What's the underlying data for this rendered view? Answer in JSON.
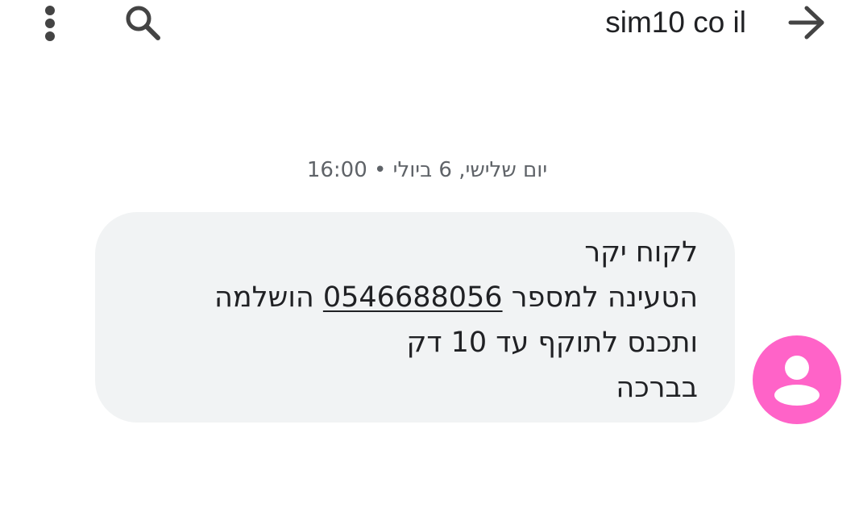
{
  "header": {
    "title": "sim10 co il",
    "back_icon": "arrow-forward-icon",
    "search_icon": "search-icon",
    "menu_icon": "more-vertical-icon"
  },
  "conversation": {
    "timestamp": "יום שלישי, 6 ביולי • 16:00",
    "message": {
      "greeting": "לקוח יקר",
      "line2_prefix": "הטעינה למספר",
      "phone_number": "0546688056",
      "line2_suffix": "הושלמה",
      "line3": "ותכנס לתוקף עד 10 דק",
      "closing": "בברכה"
    },
    "avatar": {
      "icon": "person-icon",
      "color": "#ff63c8"
    }
  },
  "colors": {
    "bubble_bg": "#f1f3f4",
    "text": "#202124",
    "muted_text": "#5f6368",
    "avatar": "#ff63c8"
  }
}
